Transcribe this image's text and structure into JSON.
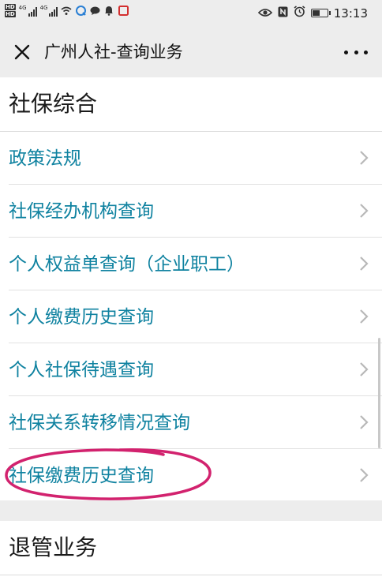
{
  "status_bar": {
    "hd_label": "HD",
    "net_label": "4G",
    "time": "13:13",
    "battery_level": 0.55
  },
  "navbar": {
    "title": "广州人社-查询业务"
  },
  "sections": [
    {
      "title": "社保综合",
      "items": [
        {
          "label": "政策法规"
        },
        {
          "label": "社保经办机构查询"
        },
        {
          "label": "个人权益单查询（企业职工）"
        },
        {
          "label": "个人缴费历史查询"
        },
        {
          "label": "个人社保待遇查询"
        },
        {
          "label": "社保关系转移情况查询"
        },
        {
          "label": "社保缴费历史查询"
        }
      ]
    },
    {
      "title": "退管业务"
    }
  ],
  "colors": {
    "link": "#0f82a0",
    "highlight_circle": "#d2226e",
    "background": "#ededed"
  },
  "icons": [
    "close-icon",
    "more-icon",
    "chevron-right-icon",
    "wifi-icon",
    "battery-icon",
    "alarm-icon",
    "nfc-icon",
    "eye-icon",
    "bell-icon",
    "message-icon"
  ]
}
